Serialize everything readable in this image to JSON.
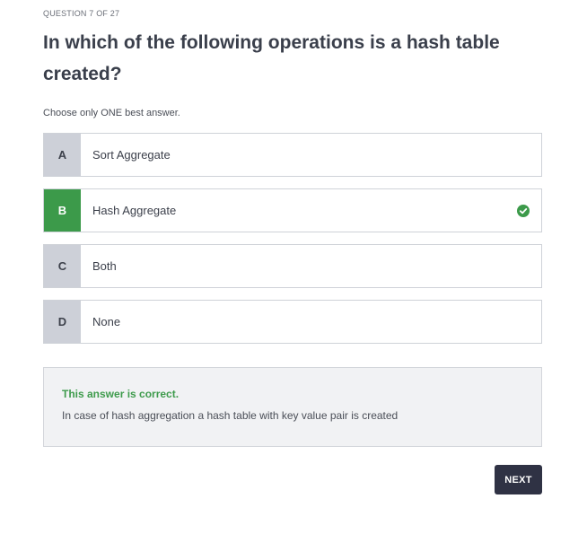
{
  "header": {
    "counter": "QUESTION 7 OF 27"
  },
  "question": {
    "text": "In which of the following operations is a hash table created?",
    "instruction": "Choose only ONE best answer."
  },
  "options": [
    {
      "letter": "A",
      "label": "Sort Aggregate",
      "selected": false
    },
    {
      "letter": "B",
      "label": "Hash Aggregate",
      "selected": true,
      "icon": "check-circle-icon"
    },
    {
      "letter": "C",
      "label": "Both",
      "selected": false
    },
    {
      "letter": "D",
      "label": "None",
      "selected": false
    }
  ],
  "feedback": {
    "status": "This answer is correct.",
    "explanation": "In case of hash aggregation a hash table with key value pair is created"
  },
  "actions": {
    "next_label": "NEXT"
  },
  "colors": {
    "correct": "#3c9a4a",
    "letter_bg": "#cdd0d8",
    "button_bg": "#2f3244",
    "feedback_bg": "#f1f2f4"
  }
}
